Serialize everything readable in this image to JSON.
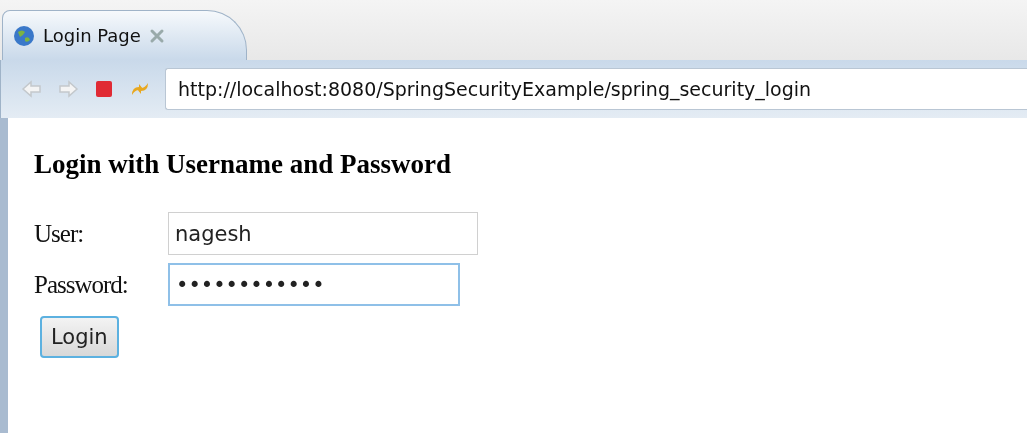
{
  "tab": {
    "label": "Login Page",
    "selected": true
  },
  "toolbar": {
    "buttons": [
      {
        "kind": "back",
        "disabled": true
      },
      {
        "kind": "forward",
        "disabled": true
      },
      {
        "kind": "stop",
        "disabled": false
      },
      {
        "kind": "refresh",
        "disabled": false
      }
    ],
    "url": "http://localhost:8080/SpringSecurityExample/spring_security_login"
  },
  "page": {
    "heading": "Login with Username and Password",
    "fields": [
      {
        "label": "User:",
        "value": "nagesh",
        "focused": false
      },
      {
        "label": "Password:",
        "value": "••••••••••••",
        "focused": true
      }
    ],
    "button": "Login"
  }
}
